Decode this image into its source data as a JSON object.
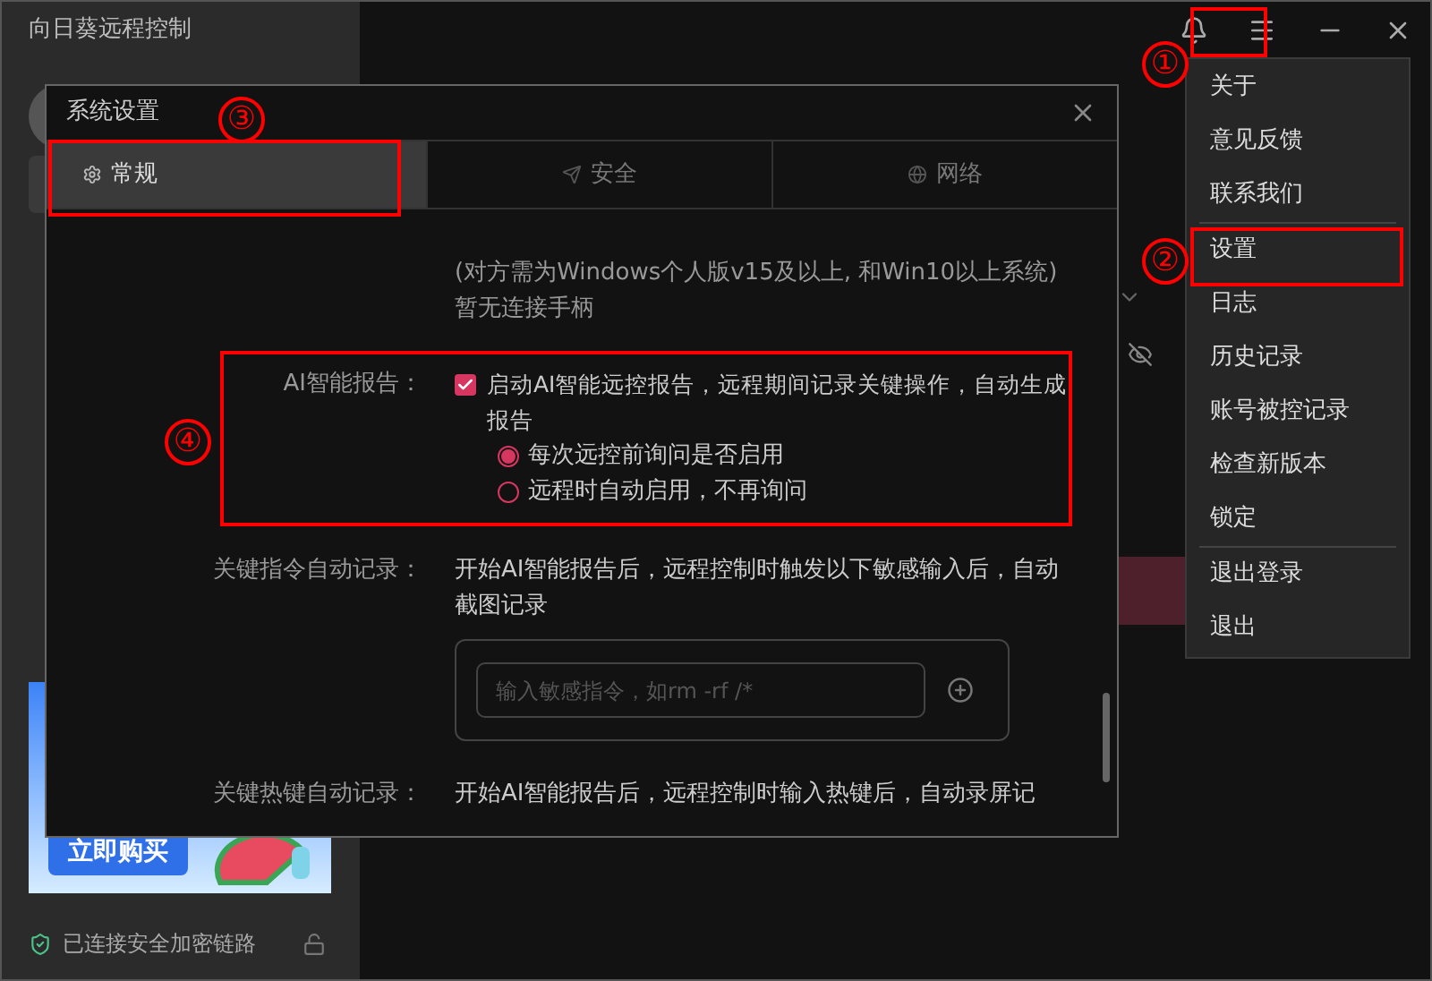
{
  "window": {
    "title": "向日葵远程控制"
  },
  "sidebar": {
    "banner": {
      "button": "立即购买"
    },
    "status": "已连接安全加密链路"
  },
  "dialog": {
    "title": "系统设置",
    "tabs": [
      {
        "label": "常规",
        "selected": true
      },
      {
        "label": "安全",
        "selected": false
      },
      {
        "label": "网络",
        "selected": false
      }
    ],
    "notes": [
      "(对方需为Windows个人版v15及以上, 和Win10以上系统)",
      "暂无连接手柄"
    ],
    "ai_report": {
      "label": "AI智能报告：",
      "checkbox": {
        "label": "启动AI智能远控报告，远程期间记录关键操作，自动生成报告",
        "checked": true
      },
      "options": [
        {
          "label": "每次远控前询问是否启用",
          "selected": true
        },
        {
          "label": "远程时自动启用，不再询问",
          "selected": false
        }
      ]
    },
    "key_command": {
      "label": "关键指令自动记录：",
      "description": "开始AI智能报告后，远程控制时触发以下敏感输入后，自动截图记录",
      "input": {
        "placeholder": "输入敏感指令，如rm -rf /*"
      }
    },
    "key_hotkey": {
      "label": "关键热键自动记录：",
      "description": "开始AI智能报告后，远程控制时输入热键后，自动录屏记"
    }
  },
  "menu": {
    "groups": [
      [
        "关于",
        "意见反馈",
        "联系我们"
      ],
      [
        "设置",
        "日志",
        "历史记录",
        "账号被控记录",
        "检查新版本",
        "锁定"
      ],
      [
        "退出登录",
        "退出"
      ]
    ]
  },
  "annotations": [
    {
      "label": "①"
    },
    {
      "label": "②"
    },
    {
      "label": "③"
    },
    {
      "label": "④"
    }
  ]
}
